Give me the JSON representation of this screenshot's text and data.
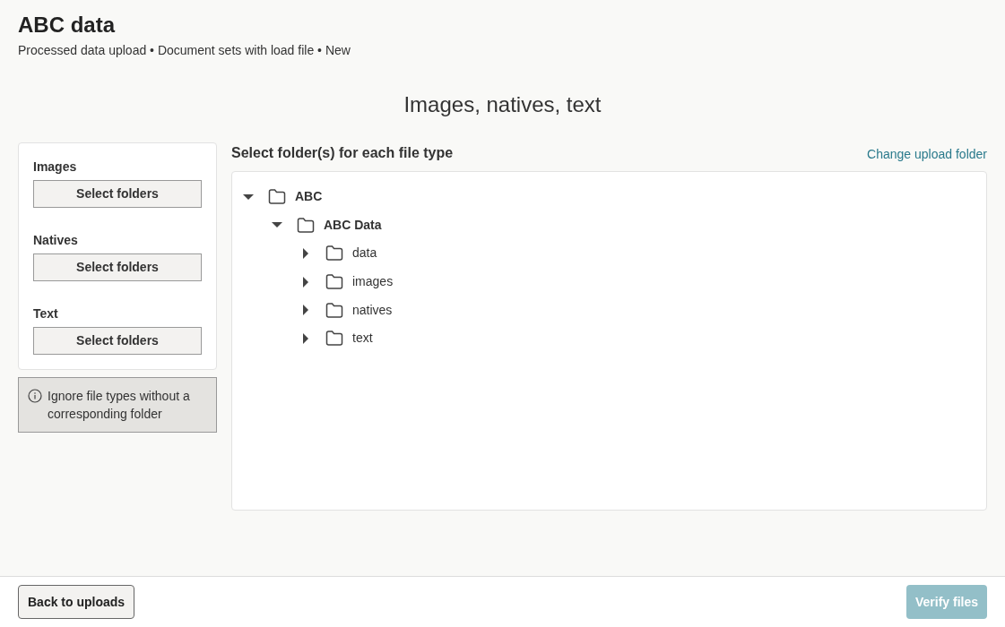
{
  "header": {
    "title": "ABC data",
    "breadcrumb": "Processed data upload • Document sets with load file • New"
  },
  "section_title": "Images, natives, text",
  "file_types": [
    {
      "label": "Images",
      "button": "Select folders"
    },
    {
      "label": "Natives",
      "button": "Select folders"
    },
    {
      "label": "Text",
      "button": "Select folders"
    }
  ],
  "ignore_option": {
    "label": "Ignore file types without a corresponding folder"
  },
  "folder_panel": {
    "title": "Select folder(s) for each file type",
    "link": "Change upload folder",
    "tree": [
      {
        "name": "ABC",
        "expanded": true,
        "children": [
          {
            "name": "ABC Data",
            "expanded": true,
            "children": [
              {
                "name": "data",
                "expanded": false
              },
              {
                "name": "images",
                "expanded": false
              },
              {
                "name": "natives",
                "expanded": false
              },
              {
                "name": "text",
                "expanded": false
              }
            ]
          }
        ]
      }
    ]
  },
  "footer": {
    "back_button": "Back to uploads",
    "verify_button": {
      "label": "Verify files",
      "disabled": true
    }
  }
}
